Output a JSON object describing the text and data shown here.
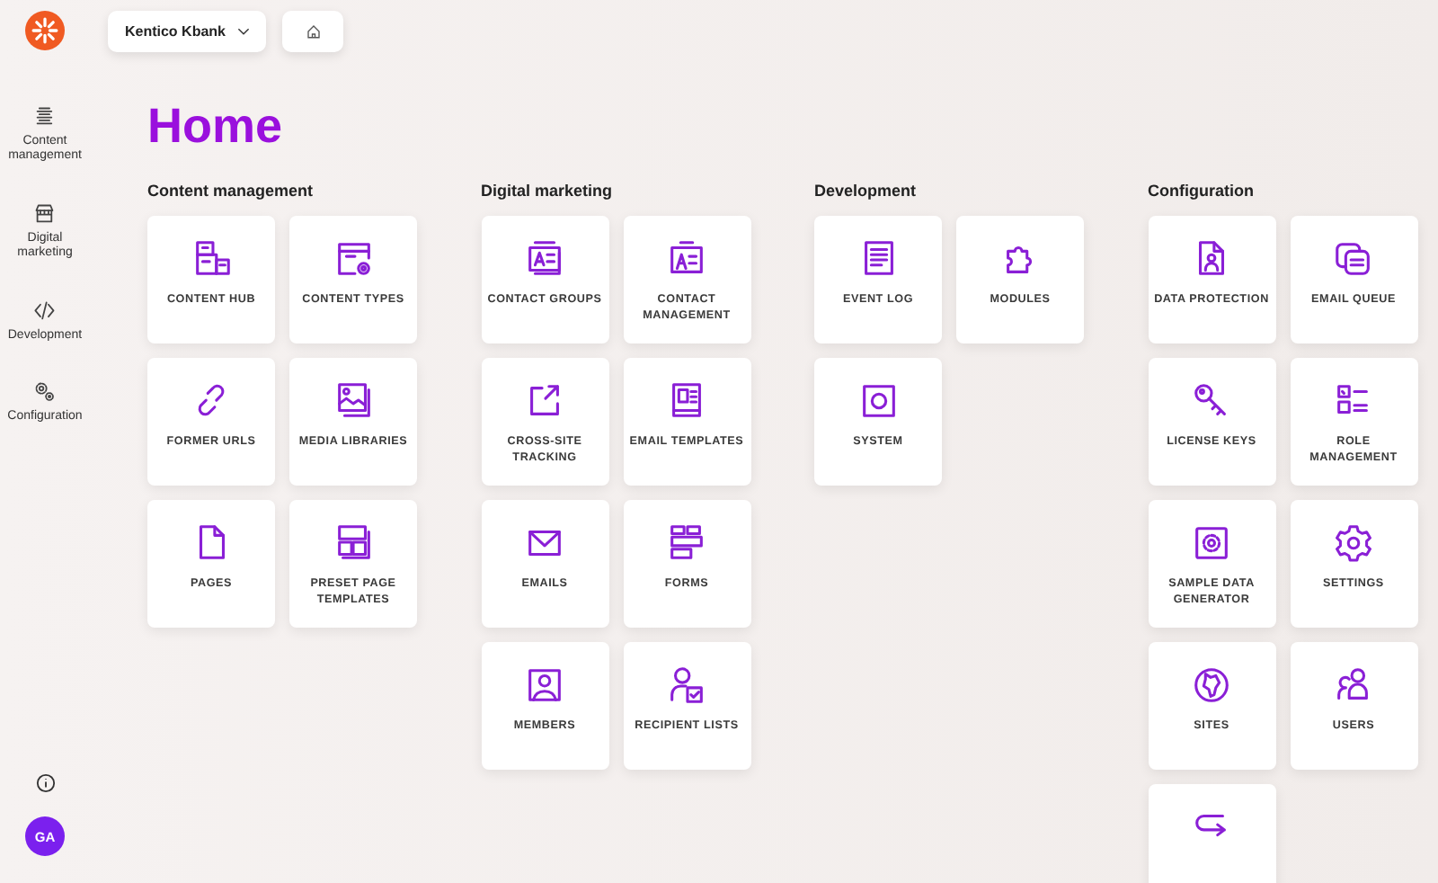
{
  "logo": {
    "kind": "asterisk"
  },
  "sidebar": {
    "items": [
      {
        "label": "Content management",
        "kind": "content",
        "selected": false
      },
      {
        "label": "Digital marketing",
        "kind": "store",
        "selected": false
      },
      {
        "label": "Development",
        "kind": "code",
        "selected": false
      },
      {
        "label": "Configuration",
        "kind": "gears",
        "selected": false
      }
    ],
    "avatar": "GA"
  },
  "topbar": {
    "site_selector": "Kentico Kbank"
  },
  "title": "Home",
  "sections": [
    {
      "title": "Content management",
      "tiles": [
        {
          "label": "CONTENT HUB",
          "kind": "boxes"
        },
        {
          "label": "CONTENT TYPES",
          "kind": "window-gear"
        },
        {
          "label": "FORMER URLS",
          "kind": "link"
        },
        {
          "label": "MEDIA LIBRARIES",
          "kind": "image"
        },
        {
          "label": "PAGES",
          "kind": "page"
        },
        {
          "label": "PRESET PAGE TEMPLATES",
          "kind": "layout"
        }
      ]
    },
    {
      "title": "Digital marketing",
      "tiles": [
        {
          "label": "CONTACT GROUPS",
          "kind": "cards"
        },
        {
          "label": "CONTACT MANAGEMENT",
          "kind": "card"
        },
        {
          "label": "CROSS-SITE TRACKING",
          "kind": "external"
        },
        {
          "label": "EMAIL TEMPLATES",
          "kind": "newsletter"
        },
        {
          "label": "EMAILS",
          "kind": "envelope"
        },
        {
          "label": "FORMS",
          "kind": "form"
        },
        {
          "label": "MEMBERS",
          "kind": "portrait"
        },
        {
          "label": "RECIPIENT LISTS",
          "kind": "person-check"
        }
      ]
    },
    {
      "title": "Development",
      "tiles": [
        {
          "label": "EVENT LOG",
          "kind": "document"
        },
        {
          "label": "MODULES",
          "kind": "puzzle"
        },
        {
          "label": "SYSTEM",
          "kind": "square-circle"
        }
      ]
    },
    {
      "title": "Configuration",
      "tiles": [
        {
          "label": "DATA PROTECTION",
          "kind": "file-person"
        },
        {
          "label": "EMAIL QUEUE",
          "kind": "stack"
        },
        {
          "label": "LICENSE KEYS",
          "kind": "key"
        },
        {
          "label": "ROLE MANAGEMENT",
          "kind": "checklist"
        },
        {
          "label": "SAMPLE DATA GENERATOR",
          "kind": "gear-box"
        },
        {
          "label": "SETTINGS",
          "kind": "gear"
        },
        {
          "label": "SITES",
          "kind": "globe"
        },
        {
          "label": "USERS",
          "kind": "people"
        },
        {
          "kind": "return-arrow"
        }
      ]
    }
  ]
}
